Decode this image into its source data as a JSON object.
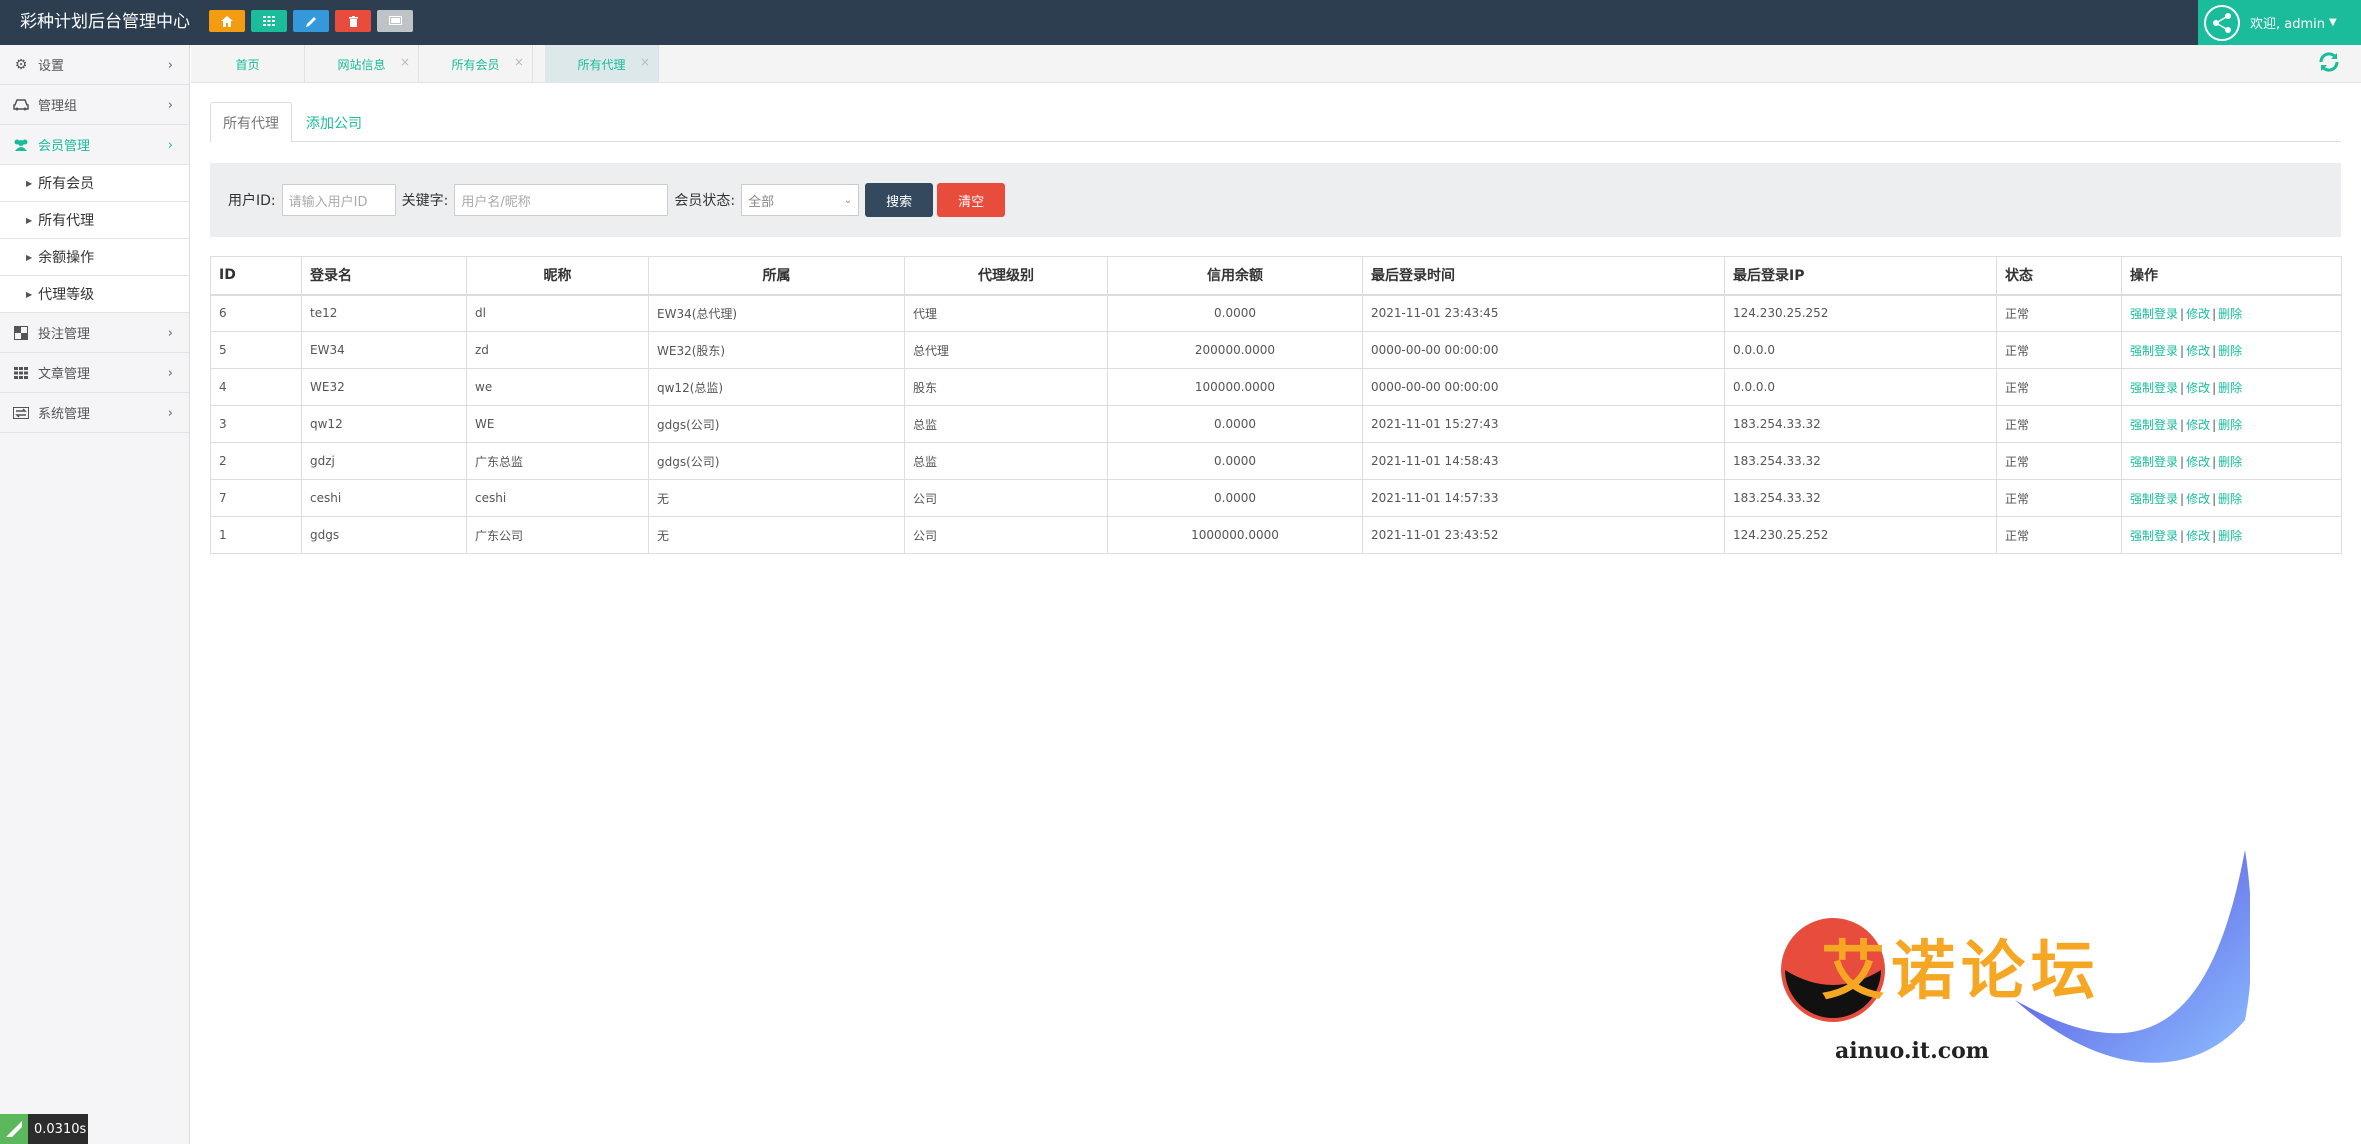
{
  "app": {
    "title": "彩种计划后台管理中心",
    "timer": "0.0310s"
  },
  "topbar": {
    "quick_buttons": [
      {
        "icon": "home-icon",
        "color": "#f39c12"
      },
      {
        "icon": "grid-icon",
        "color": "#1abc9c"
      },
      {
        "icon": "pencil-icon",
        "color": "#3498db"
      },
      {
        "icon": "trash-icon",
        "color": "#e74c3c"
      },
      {
        "icon": "monitor-icon",
        "color": "#bdc3c7"
      }
    ],
    "user_label": "欢迎, admin"
  },
  "sidebar": {
    "items": [
      {
        "label": "设置",
        "icon": "gears-icon"
      },
      {
        "label": "管理组",
        "icon": "car-icon"
      },
      {
        "label": "会员管理",
        "icon": "users-icon",
        "active": true
      },
      {
        "label": "投注管理",
        "icon": "checkerboard-icon"
      },
      {
        "label": "文章管理",
        "icon": "grid-icon"
      },
      {
        "label": "系统管理",
        "icon": "exchange-icon"
      }
    ],
    "sub_items": [
      "所有会员",
      "所有代理",
      "余额操作",
      "代理等级"
    ]
  },
  "page_tabs": [
    {
      "label": "首页"
    },
    {
      "label": "网站信息"
    },
    {
      "label": "所有会员"
    },
    {
      "label": "所有代理",
      "current": true
    }
  ],
  "sub_tabs": {
    "active": "所有代理",
    "link": "添加公司"
  },
  "filter": {
    "user_id_label": "用户ID:",
    "user_id_placeholder": "请输入用户ID",
    "keyword_label": "关键字:",
    "keyword_placeholder": "用户名/昵称",
    "status_label": "会员状态:",
    "status_value": "全部",
    "search_label": "搜索",
    "clear_label": "清空"
  },
  "table": {
    "headers": [
      "ID",
      "登录名",
      "昵称",
      "所属",
      "代理级别",
      "信用余额",
      "最后登录时间",
      "最后登录IP",
      "状态",
      "操作"
    ],
    "rows": [
      {
        "id": "6",
        "login": "te12",
        "nick": "dl",
        "belong": "EW34(总代理)",
        "level": "代理",
        "credit": "0.0000",
        "time": "2021-11-01 23:43:45",
        "ip": "124.230.25.252",
        "status": "正常"
      },
      {
        "id": "5",
        "login": "EW34",
        "nick": "zd",
        "belong": "WE32(股东)",
        "level": "总代理",
        "credit": "200000.0000",
        "time": "0000-00-00 00:00:00",
        "ip": "0.0.0.0",
        "status": "正常"
      },
      {
        "id": "4",
        "login": "WE32",
        "nick": "we",
        "belong": "qw12(总监)",
        "level": "股东",
        "credit": "100000.0000",
        "time": "0000-00-00 00:00:00",
        "ip": "0.0.0.0",
        "status": "正常"
      },
      {
        "id": "3",
        "login": "qw12",
        "nick": "WE",
        "belong": "gdgs(公司)",
        "level": "总监",
        "credit": "0.0000",
        "time": "2021-11-01 15:27:43",
        "ip": "183.254.33.32",
        "status": "正常"
      },
      {
        "id": "2",
        "login": "gdzj",
        "nick": "广东总监",
        "belong": "gdgs(公司)",
        "level": "总监",
        "credit": "0.0000",
        "time": "2021-11-01 14:58:43",
        "ip": "183.254.33.32",
        "status": "正常"
      },
      {
        "id": "7",
        "login": "ceshi",
        "nick": "ceshi",
        "belong": "无",
        "level": "公司",
        "credit": "0.0000",
        "time": "2021-11-01 14:57:33",
        "ip": "183.254.33.32",
        "status": "正常"
      },
      {
        "id": "1",
        "login": "gdgs",
        "nick": "广东公司",
        "belong": "无",
        "level": "公司",
        "credit": "1000000.0000",
        "time": "2021-11-01 23:43:52",
        "ip": "124.230.25.252",
        "status": "正常"
      }
    ],
    "actions": {
      "force": "强制登录",
      "edit": "修改",
      "delete": "删除",
      "sep": "|"
    }
  },
  "watermark": {
    "text": "艾诺论坛",
    "url": "ainuo.it.com"
  },
  "colors": {
    "topbar": "#2c3e50",
    "accent": "#1abc9c",
    "danger": "#e74c3c",
    "dark_button": "#34495e"
  }
}
